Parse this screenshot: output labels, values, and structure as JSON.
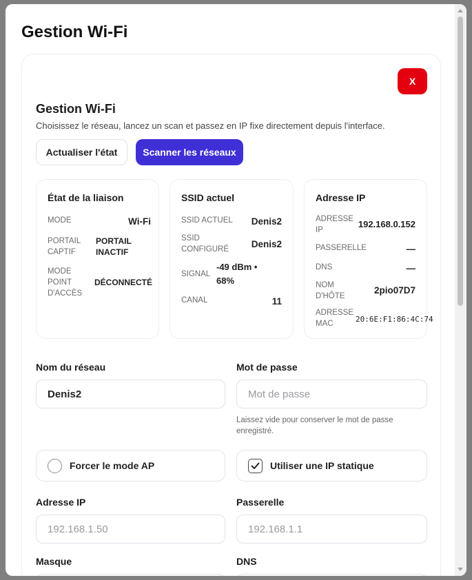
{
  "modal": {
    "title": "Gestion Wi-Fi"
  },
  "close_label": "X",
  "section": {
    "title": "Gestion Wi-Fi",
    "description": "Choisissez le réseau, lancez un scan et passez en IP fixe directement depuis l'interface."
  },
  "actions": {
    "refresh_label": "Actualiser l'état",
    "scan_label": "Scanner les réseaux"
  },
  "link_card": {
    "title": "État de la liaison",
    "rows": [
      {
        "key": "MODE",
        "value": "Wi-Fi"
      },
      {
        "key": "PORTAIL CAPTIF",
        "value": "PORTAIL INACTIF"
      },
      {
        "key": "MODE POINT D'ACCÈS",
        "value": "DÉCONNECTÉ"
      }
    ]
  },
  "ssid_card": {
    "title": "SSID actuel",
    "rows": [
      {
        "key": "SSID ACTUEL",
        "value": "Denis2"
      },
      {
        "key": "SSID CONFIGURÉ",
        "value": "Denis2"
      },
      {
        "key": "SIGNAL",
        "value": "-49 dBm • 68%"
      },
      {
        "key": "CANAL",
        "value": "11"
      }
    ]
  },
  "ip_card": {
    "title": "Adresse IP",
    "rows": [
      {
        "key": "ADRESSE IP",
        "value": "192.168.0.152"
      },
      {
        "key": "PASSERELLE",
        "value": "—"
      },
      {
        "key": "DNS",
        "value": "—"
      },
      {
        "key": "NOM D'HÔTE",
        "value": "2pio07D7"
      },
      {
        "key": "ADRESSE MAC",
        "value": "20:6E:F1:86:4C:74"
      }
    ]
  },
  "form": {
    "network_label": "Nom du réseau",
    "network_value": "Denis2",
    "password_label": "Mot de passe",
    "password_placeholder": "Mot de passe",
    "password_help": "Laissez vide pour conserver le mot de passe enregistré.",
    "force_ap_label": "Forcer le mode AP",
    "force_ap_checked": false,
    "static_ip_label": "Utiliser une IP statique",
    "static_ip_checked": true,
    "ip_label": "Adresse IP",
    "ip_placeholder": "192.168.1.50",
    "gateway_label": "Passerelle",
    "gateway_placeholder": "192.168.1.1",
    "mask_label": "Masque",
    "dns_label": "DNS"
  },
  "colors": {
    "primary": "#3f2fd6",
    "danger": "#e3000f"
  }
}
